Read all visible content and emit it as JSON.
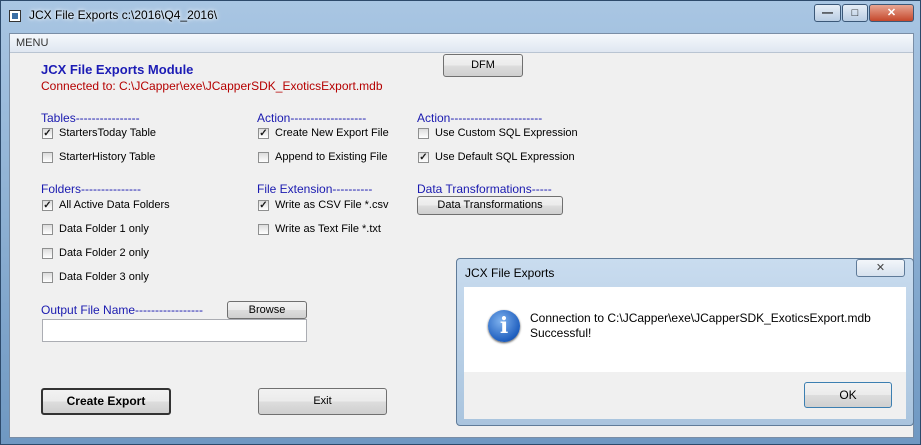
{
  "window": {
    "title": "JCX File Exports c:\\2016\\Q4_2016\\",
    "controls": {
      "minimize": "—",
      "maximize": "□",
      "close": "✕"
    }
  },
  "menu": {
    "label": "MENU"
  },
  "header": {
    "title": "JCX File Exports Module",
    "connection": "Connected to: C:\\JCapper\\exe\\JCapperSDK_ExoticsExport.mdb",
    "dfm_button": "DFM"
  },
  "tables": {
    "heading": "Tables----------------",
    "items": [
      {
        "label": "StartersToday Table",
        "checked": true
      },
      {
        "label": "StarterHistory Table",
        "checked": false
      }
    ]
  },
  "action1": {
    "heading": "Action-------------------",
    "items": [
      {
        "label": "Create New Export File",
        "checked": true
      },
      {
        "label": "Append to Existing File",
        "checked": false
      }
    ]
  },
  "action2": {
    "heading": "Action-----------------------",
    "items": [
      {
        "label": "Use Custom SQL Expression",
        "checked": false
      },
      {
        "label": "Use Default SQL Expression",
        "checked": true
      }
    ]
  },
  "folders": {
    "heading": "Folders---------------",
    "items": [
      {
        "label": "All Active Data Folders",
        "checked": true
      },
      {
        "label": "Data Folder 1 only",
        "checked": false
      },
      {
        "label": "Data Folder 2 only",
        "checked": false
      },
      {
        "label": "Data Folder 3 only",
        "checked": false
      }
    ]
  },
  "file_extension": {
    "heading": "File Extension----------",
    "items": [
      {
        "label": "Write as CSV File  *.csv",
        "checked": true
      },
      {
        "label": "Write as Text File *.txt",
        "checked": false
      }
    ]
  },
  "transformations": {
    "heading": "Data Transformations-----",
    "button": "Data Transformations"
  },
  "output": {
    "label": "Output File Name-----------------",
    "browse_button": "Browse",
    "value": ""
  },
  "footer": {
    "create_button": "Create Export",
    "exit_button": "Exit"
  },
  "dialog": {
    "title": "JCX File Exports",
    "close": "✕",
    "message_line1": "Connection to C:\\JCapper\\exe\\JCapperSDK_ExoticsExport.mdb",
    "message_line2": "Successful!",
    "icon_glyph": "i",
    "ok_button": "OK"
  }
}
